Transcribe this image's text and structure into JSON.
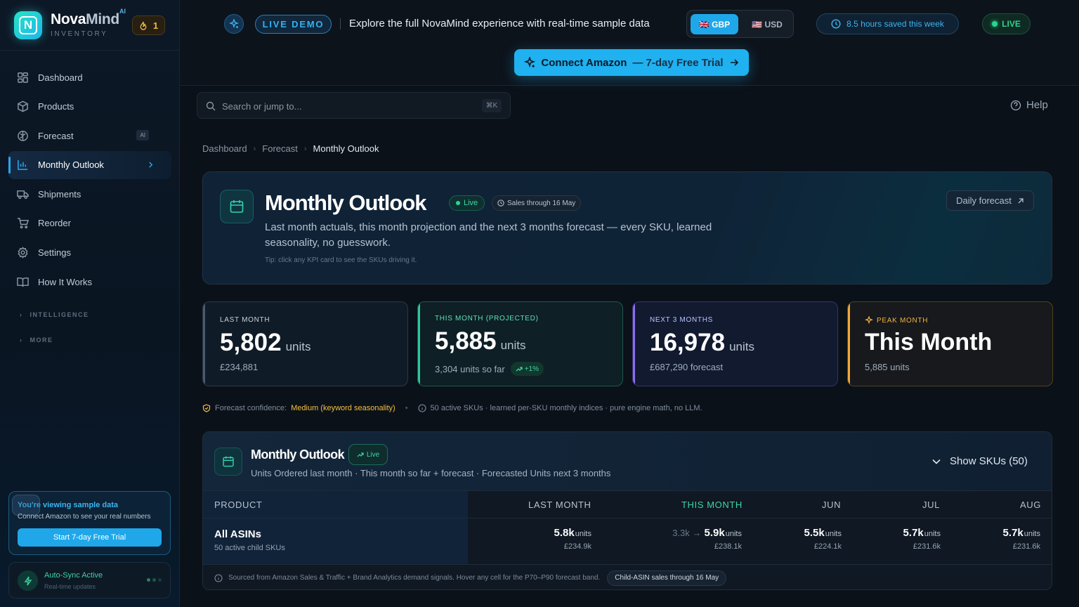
{
  "brand": {
    "name_a": "Nova",
    "name_b": "Mind",
    "ai": "AI",
    "subtitle": "INVENTORY",
    "streak": "1"
  },
  "nav": {
    "items": [
      {
        "label": "Dashboard",
        "icon": "grid-icon"
      },
      {
        "label": "Products",
        "icon": "box-icon"
      },
      {
        "label": "Forecast",
        "icon": "brain-icon",
        "badge": "AI"
      },
      {
        "label": "Monthly Outlook",
        "icon": "bar-chart-icon",
        "active": true
      },
      {
        "label": "Shipments",
        "icon": "truck-icon"
      },
      {
        "label": "Reorder",
        "icon": "cart-icon"
      },
      {
        "label": "Settings",
        "icon": "gear-icon"
      },
      {
        "label": "How It Works",
        "icon": "book-icon"
      }
    ],
    "sections": [
      "INTELLIGENCE",
      "MORE"
    ]
  },
  "sample": {
    "title": "You're viewing sample data",
    "subtitle": "Connect Amazon to see your real numbers",
    "button": "Start 7-day Free Trial"
  },
  "sync": {
    "title": "Auto-Sync Active",
    "subtitle": "Real-time updates"
  },
  "topbar": {
    "live_demo": "LIVE DEMO",
    "explore": "Explore the full NovaMind experience with real-time sample data",
    "gbp": "🇬🇧 GBP",
    "usd": "🇺🇸 USD",
    "saved": "8.5 hours saved this week",
    "live": "LIVE",
    "connect": "Connect Amazon",
    "connect_suffix": "— 7-day Free Trial"
  },
  "search": {
    "placeholder": "Search or jump to...",
    "shortcut": "⌘K"
  },
  "help": "Help",
  "breadcrumb": [
    "Dashboard",
    "Forecast",
    "Monthly Outlook"
  ],
  "hero": {
    "title": "Monthly Outlook",
    "live": "Live",
    "date": "Sales through 16 May",
    "description": "Last month actuals, this month projection and the next 3 months forecast — every SKU, learned seasonality, no guesswork.",
    "tip": "Tip: click any KPI card to see the SKUs driving it.",
    "daily": "Daily forecast"
  },
  "kpis": [
    {
      "label": "LAST MONTH",
      "value": "5,802",
      "unit": "units",
      "sub": "£234,881"
    },
    {
      "label": "THIS MONTH (PROJECTED)",
      "value": "5,885",
      "unit": "units",
      "sub": "3,304 units so far",
      "trend": "+1%"
    },
    {
      "label": "NEXT 3 MONTHS",
      "value": "16,978",
      "unit": "units",
      "sub": "£687,290 forecast"
    },
    {
      "label": "PEAK MONTH",
      "value": "This Month",
      "sub": "5,885 units"
    }
  ],
  "notes": {
    "confidence_label": "Forecast confidence:",
    "confidence_value": "Medium (keyword seasonality)",
    "info": "50 active SKUs · learned per-SKU monthly indices · pure engine math, no LLM."
  },
  "table": {
    "title": "Monthly Outlook",
    "live": "Live",
    "subtitle": "Units Ordered last month · This month so far + forecast · Forecasted Units next 3 months",
    "show_skus": "Show SKUs (50)",
    "columns": [
      "PRODUCT",
      "LAST MONTH",
      "THIS MONTH",
      "JUN",
      "JUL",
      "AUG"
    ],
    "row": {
      "product": "All ASINs",
      "product_sub": "50 active child SKUs",
      "cells": [
        {
          "value": "5.8k",
          "unit": "units",
          "price": "£234.9k"
        },
        {
          "sofar": "3.3k →",
          "value": "5.9k",
          "unit": "units",
          "price": "£238.1k"
        },
        {
          "value": "5.5k",
          "unit": "units",
          "price": "£224.1k"
        },
        {
          "value": "5.7k",
          "unit": "units",
          "price": "£231.6k"
        },
        {
          "value": "5.7k",
          "unit": "units",
          "price": "£231.6k"
        }
      ]
    },
    "footer": "Sourced from Amazon Sales & Traffic + Brand Analytics demand signals. Hover any cell for the P70–P90 forecast band.",
    "footer_pill": "Child-ASIN sales through 16 May"
  },
  "colors": {
    "accent": "#1fb1f0",
    "live": "#2ed28e",
    "peak": "#f0a83a",
    "projected": "#2cc89a",
    "next": "#8a6df0"
  }
}
